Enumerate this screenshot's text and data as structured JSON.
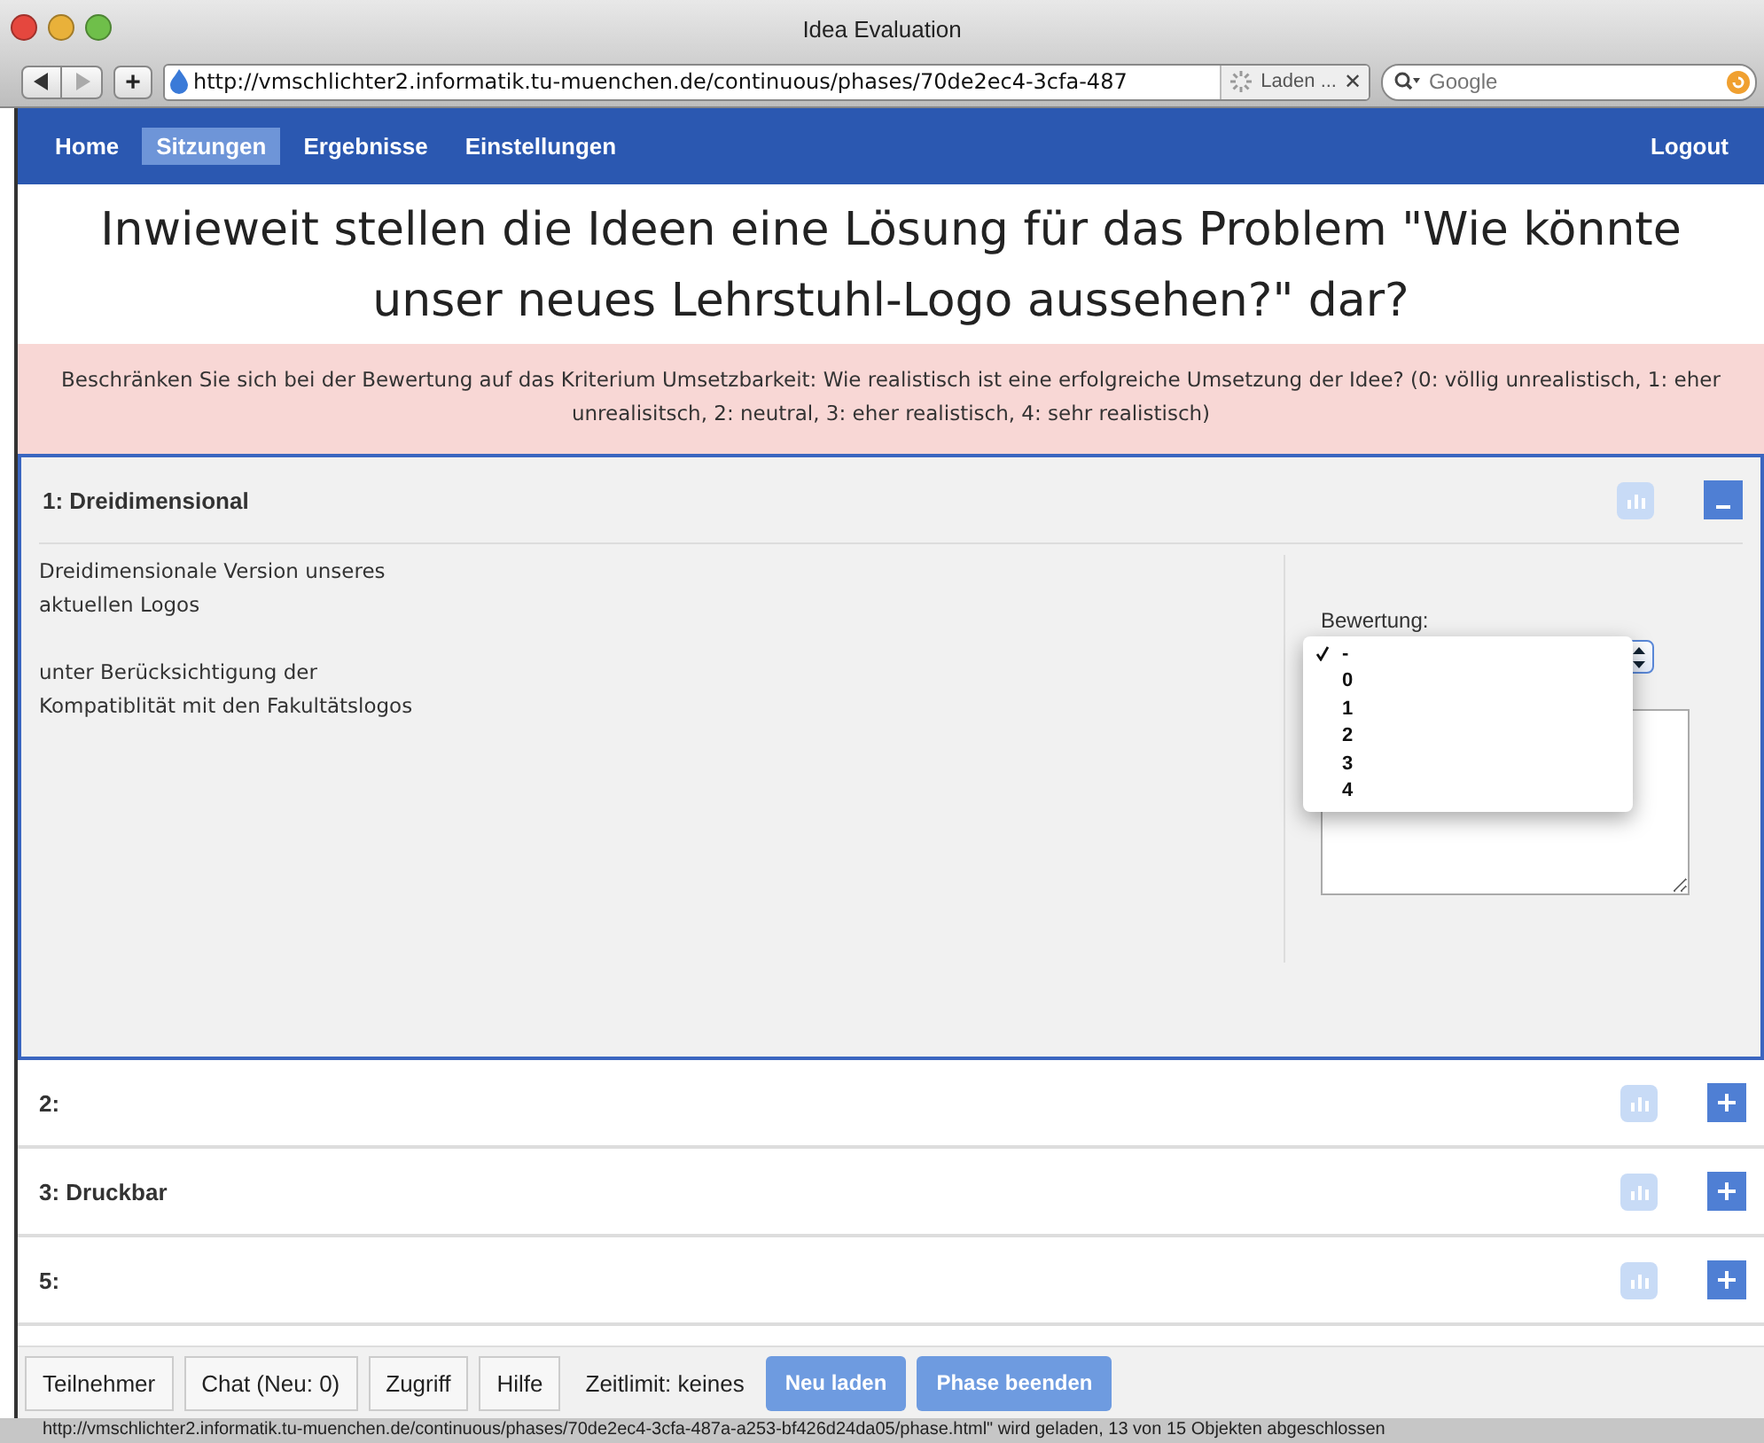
{
  "window": {
    "title": "Idea Evaluation"
  },
  "browser": {
    "add_label": "+",
    "url": "http://vmschlichter2.informatik.tu-muenchen.de/continuous/phases/70de2ec4-3cfa-487",
    "tab_label": "Laden ...",
    "tab_close": "✕",
    "search_placeholder": "Google"
  },
  "nav": {
    "items": [
      {
        "label": "Home",
        "selected": false
      },
      {
        "label": "Sitzungen",
        "selected": true
      },
      {
        "label": "Ergebnisse",
        "selected": false
      },
      {
        "label": "Einstellungen",
        "selected": false
      }
    ],
    "logout": "Logout"
  },
  "heading": "Inwieweit stellen die Ideen eine Lösung für das Problem \"Wie könnte unser neues Lehrstuhl-Logo aussehen?\" dar?",
  "criterion": "Beschränken Sie sich bei der Bewertung auf das Kriterium Umsetzbarkeit: Wie realistisch ist eine erfolgreiche Umsetzung der Idee? (0: völlig unrealistisch, 1: eher unrealisitsch, 2: neutral, 3: eher realistisch, 4: sehr realistisch)",
  "ideas": [
    {
      "title": "1: Dreidimensional",
      "expanded": true,
      "description": [
        "Dreidimensionale Version unseres aktuellen Logos",
        "unter Berücksichtigung der Kompatiblität mit den Fakultätslogos"
      ],
      "rating_label": "Bewertung:",
      "rating_options": [
        {
          "label": "-",
          "selected": true
        },
        {
          "label": "0",
          "selected": false
        },
        {
          "label": "1",
          "selected": false
        },
        {
          "label": "2",
          "selected": false
        },
        {
          "label": "3",
          "selected": false
        },
        {
          "label": "4",
          "selected": false
        }
      ]
    },
    {
      "title": "2:",
      "expanded": false
    },
    {
      "title": "3: Druckbar",
      "expanded": false
    },
    {
      "title": "5:",
      "expanded": false
    }
  ],
  "footer": {
    "tabs": [
      "Teilnehmer",
      "Chat (Neu: 0)",
      "Zugriff",
      "Hilfe"
    ],
    "time_limit": "Zeitlimit: keines",
    "actions": [
      "Neu laden",
      "Phase beenden"
    ]
  },
  "status_bar": "http://vmschlichter2.informatik.tu-muenchen.de/continuous/phases/70de2ec4-3cfa-487a-a253-bf426d24da05/phase.html\" wird geladen, 13 von 15 Objekten abgeschlossen"
}
